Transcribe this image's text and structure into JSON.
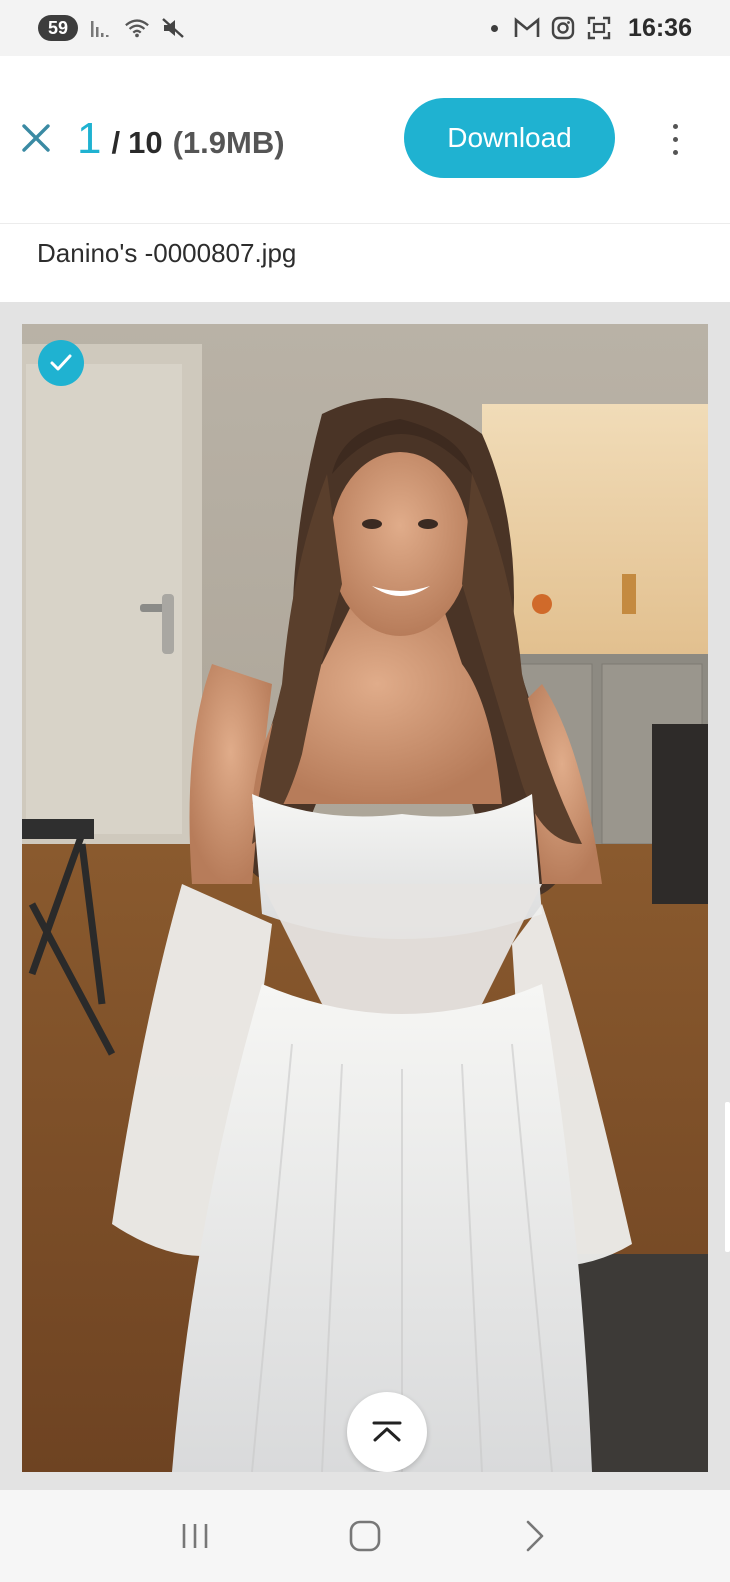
{
  "status_bar": {
    "notification_count": "59",
    "time": "16:36",
    "icons": [
      "signal-icon",
      "wifi-icon",
      "mute-icon",
      "dot-icon",
      "gmail-icon",
      "instagram-icon",
      "screenshot-icon"
    ]
  },
  "header": {
    "current_index": "1",
    "separator": "/",
    "total": "10",
    "file_size": "(1.9MB)",
    "download_label": "Download"
  },
  "file": {
    "name": "Danino's -0000807.jpg"
  },
  "viewer": {
    "selected": true,
    "accent_color": "#1fb2d1"
  },
  "nav_bar": {
    "icons": [
      "recent-apps-icon",
      "home-icon",
      "back-icon"
    ]
  }
}
